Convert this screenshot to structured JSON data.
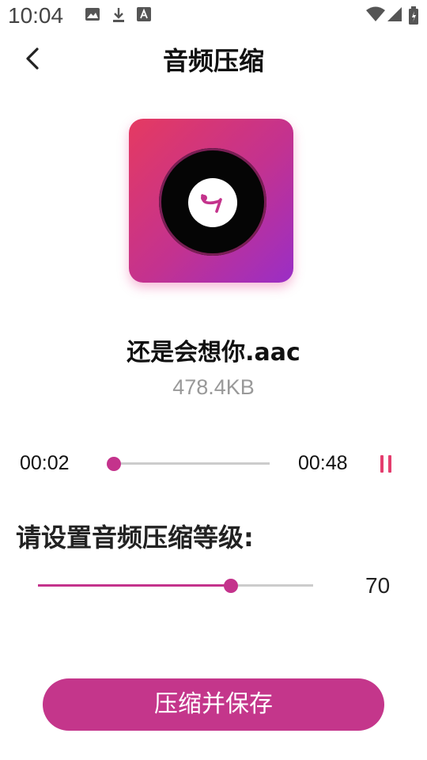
{
  "status_bar": {
    "time": "10:04",
    "left_icons": [
      "image-icon",
      "download-icon",
      "text-icon"
    ],
    "right_icons": [
      "wifi-icon",
      "signal-icon",
      "battery-icon"
    ]
  },
  "header": {
    "title": "音频压缩",
    "back_icon": "chevron-left-icon"
  },
  "cover": {
    "gradient": [
      "#e53a61",
      "#9a2ec6"
    ],
    "disc_color": "#050505",
    "logo_color": "#c4338c"
  },
  "file": {
    "name": "还是会想你.aac",
    "size": "478.4KB"
  },
  "player": {
    "current_time": "00:02",
    "duration": "00:48",
    "progress_fraction": 0.04,
    "state_icon": "pause-icon"
  },
  "compression": {
    "label": "请设置音频压缩等级:",
    "value": "70",
    "level_fraction": 0.7
  },
  "actions": {
    "save_label": "压缩并保存"
  },
  "colors": {
    "accent": "#c4338c",
    "pause": "#e43d6e",
    "track": "#cccccc"
  }
}
